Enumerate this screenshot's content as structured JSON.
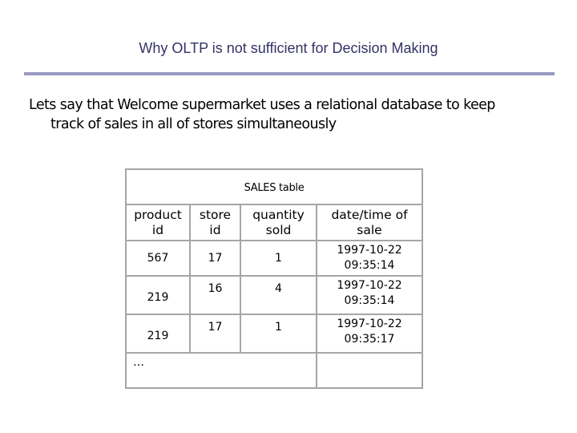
{
  "slide": {
    "title": "Why OLTP is not sufficient for Decision Making",
    "body_line1": "Lets say that Welcome supermarket uses a relational database to keep",
    "body_line2": "track of sales in all of stores simultaneously",
    "accent_color": "#9999c2",
    "title_color": "#333366"
  },
  "table": {
    "caption": "SALES table",
    "headers": [
      {
        "line1": "product",
        "line2": "id"
      },
      {
        "line1": "store",
        "line2": "id"
      },
      {
        "line1": "quantity",
        "line2": "sold"
      },
      {
        "line1": "date/time of",
        "line2": "sale"
      }
    ],
    "rows": [
      {
        "product_id": "567",
        "store_id": "17",
        "quantity_sold": "1",
        "date": "1997-10-22",
        "time": "09:35:14"
      },
      {
        "product_id": "219",
        "store_id": "16",
        "quantity_sold": "4",
        "date": "1997-10-22",
        "time": "09:35:14"
      },
      {
        "product_id": "219",
        "store_id": "17",
        "quantity_sold": "1",
        "date": "1997-10-22",
        "time": "09:35:17"
      }
    ],
    "ellipsis": "…"
  }
}
